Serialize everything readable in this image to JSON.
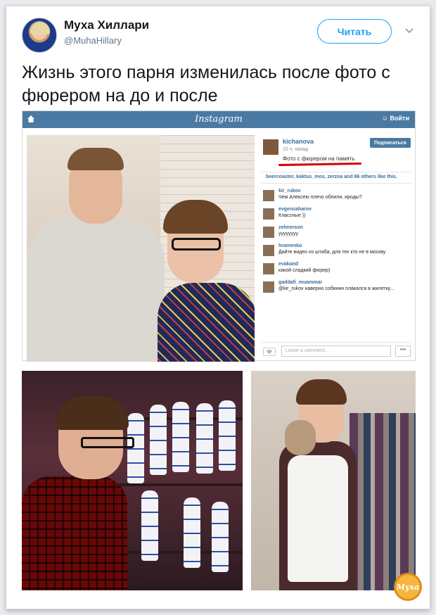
{
  "author": {
    "name": "Муха Хиллари",
    "handle": "@MuhaHillary"
  },
  "follow_label": "Читать",
  "tweet_text": "Жизнь этого парня изменилась после фото с фюрером на до и после",
  "instagram": {
    "logo": "Instagram",
    "login": "Войти",
    "post": {
      "user": "kichanova",
      "time": "10 ч. назад",
      "caption": "Фото с фюрером на память",
      "subscribe": "Подписаться",
      "likes": "beercoaster, kaktus_mos, zerzoa and 86 others like this.",
      "comment_placeholder": "Leave a comment...",
      "more": "•••"
    },
    "comments": [
      {
        "user": "kir_rukov",
        "text": "Чем Алексею плечо облили, ироды?"
      },
      {
        "user": "evgensaharov",
        "text": "Классные ))"
      },
      {
        "user": "zehnerson",
        "text": "уууууууу"
      },
      {
        "user": "hramenko",
        "text": "Дайте видео из штаба, для тех кто не в москву"
      },
      {
        "user": "evakand",
        "text": "какой сладкий фюрер)"
      },
      {
        "user": "gaddafi_muammar",
        "text": "@kir_rukov наверно собянин плакался в жилетку..."
      }
    ]
  },
  "watermark": "Муха",
  "icons": [
    "home-icon",
    "user-icon",
    "chevron-down-icon",
    "heart-icon"
  ],
  "colors": {
    "accent": "#1da1f2",
    "instagram_bar": "#4a7aa3",
    "caption_underline": "#d40000"
  }
}
